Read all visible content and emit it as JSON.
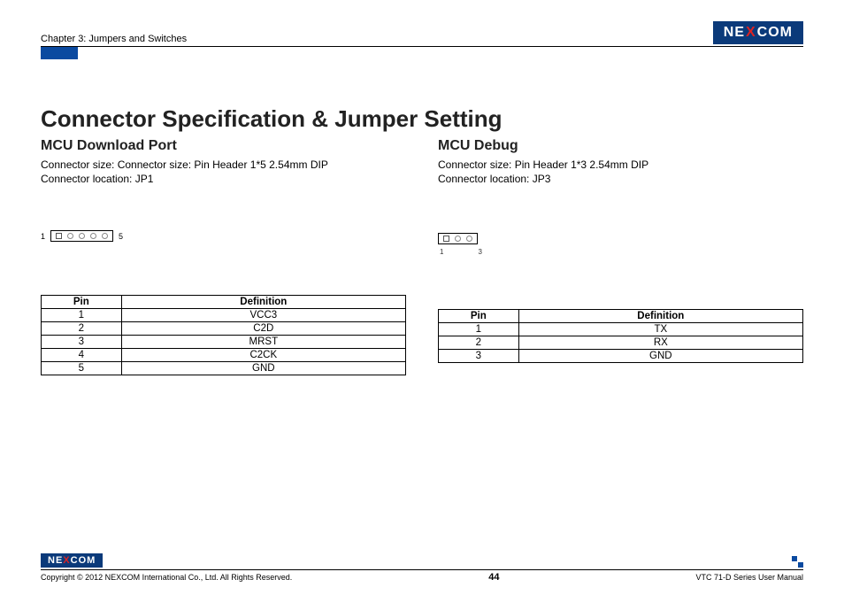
{
  "header": {
    "chapter": "Chapter 3: Jumpers and Switches",
    "logo_pre": "NE",
    "logo_x": "X",
    "logo_post": "COM"
  },
  "page_title": "Connector Specification & Jumper Setting",
  "left": {
    "title": "MCU Download Port",
    "desc_line1": "Connector size: Connector size: Pin Header 1*5 2.54mm DIP",
    "desc_line2": "Connector location: JP1",
    "diagram_left_label": "1",
    "diagram_right_label": "5",
    "th_pin": "Pin",
    "th_def": "Definition",
    "rows": [
      {
        "pin": "1",
        "def": "VCC3"
      },
      {
        "pin": "2",
        "def": "C2D"
      },
      {
        "pin": "3",
        "def": "MRST"
      },
      {
        "pin": "4",
        "def": "C2CK"
      },
      {
        "pin": "5",
        "def": "GND"
      }
    ]
  },
  "right": {
    "title": "MCU Debug",
    "desc_line1": "Connector size: Pin Header 1*3 2.54mm DIP",
    "desc_line2": "Connector location: JP3",
    "diagram_left_label": "1",
    "diagram_right_label": "3",
    "th_pin": "Pin",
    "th_def": "Definition",
    "rows": [
      {
        "pin": "1",
        "def": "TX"
      },
      {
        "pin": "2",
        "def": "RX"
      },
      {
        "pin": "3",
        "def": "GND"
      }
    ]
  },
  "footer": {
    "copyright": "Copyright © 2012 NEXCOM International Co., Ltd. All Rights Reserved.",
    "page": "44",
    "manual": "VTC 71-D Series User Manual"
  }
}
